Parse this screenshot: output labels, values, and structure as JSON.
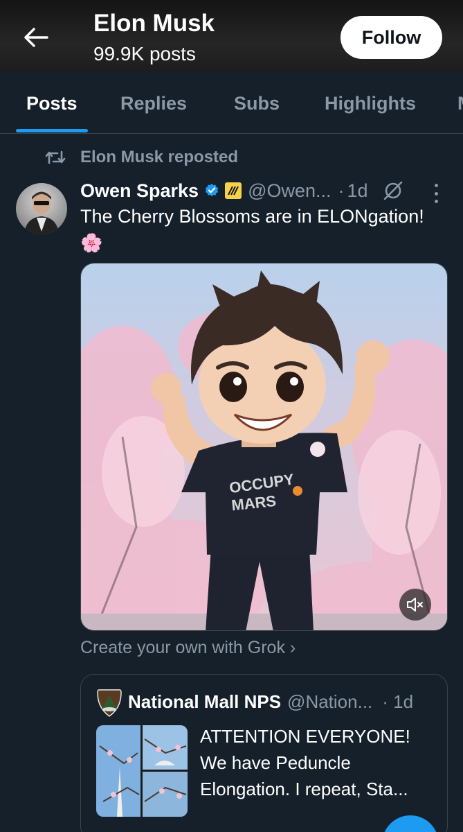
{
  "header": {
    "back_icon": "arrow-left-icon",
    "title": "Elon Musk",
    "subtitle": "99.9K posts",
    "follow_label": "Follow"
  },
  "tabs": [
    {
      "label": "Posts",
      "active": true
    },
    {
      "label": "Replies",
      "active": false
    },
    {
      "label": "Subs",
      "active": false
    },
    {
      "label": "Highlights",
      "active": false
    },
    {
      "label": "M",
      "active": false
    }
  ],
  "post": {
    "repost_label": "Elon Musk reposted",
    "author_name": "Owen Sparks",
    "handle": "@Owen...",
    "separator": "·",
    "time": "1d",
    "text": "The Cherry Blossoms are in ELONgation!",
    "emoji": "🌸",
    "media_shirt_text_1": "OCCUPY",
    "media_shirt_text_2": "MARS",
    "grok_link": "Create your own with Grok ›",
    "colors": {
      "accent": "#1d9bf0",
      "verified": "#1d9bf0",
      "background": "#15202b",
      "muted_text": "#8b98a5"
    }
  },
  "quote": {
    "author_name": "National Mall NPS",
    "handle": "@Nation...",
    "time": "· 1d",
    "text_lines": [
      "ATTENTION EVERYONE!",
      "We have Peduncle",
      "Elongation. I repeat, Sta..."
    ]
  }
}
